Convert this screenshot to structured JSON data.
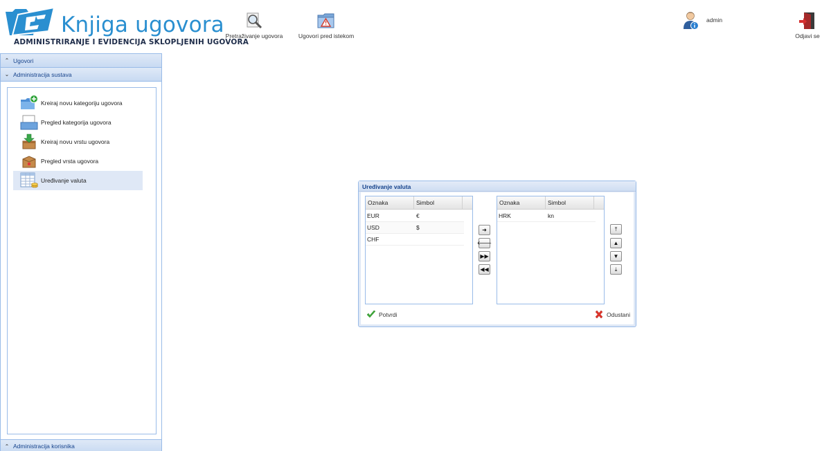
{
  "header": {
    "logo_title": "Knjiga ugovora",
    "logo_subtitle": "ADMINISTRIRANJE I EVIDENCIJA SKLOPLJENIH UGOVORA",
    "buttons": {
      "search": {
        "label": "Pretraživanje ugovora",
        "icon": "magnifier-icon"
      },
      "expired": {
        "label": "Ugovori pred istekom",
        "icon": "folder-warning-icon"
      },
      "logout": {
        "label": "Odjavi se",
        "icon": "exit-door-icon"
      }
    },
    "user": {
      "name": "admin",
      "icon": "user-info-icon"
    }
  },
  "sidebar": {
    "sections": [
      {
        "label": "Ugovori",
        "chevron": "^",
        "state": "collapsed"
      },
      {
        "label": "Administracija sustava",
        "chevron": "v",
        "state": "expanded"
      },
      {
        "label": "Administracija korisnika",
        "chevron": "^",
        "state": "collapsed"
      }
    ],
    "items": [
      {
        "label": "Kreiraj novu kategoriju ugovora",
        "icon": "folder-add-icon"
      },
      {
        "label": "Pregled kategorija ugovora",
        "icon": "folders-list-icon"
      },
      {
        "label": "Kreiraj novu vrstu ugovora",
        "icon": "box-download-icon"
      },
      {
        "label": "Pregled vrsta ugovora",
        "icon": "box-icon"
      },
      {
        "label": "Uređivanje valuta",
        "icon": "currency-table-icon",
        "selected": true
      }
    ]
  },
  "dialog": {
    "title": "Uređivanje valuta",
    "columns": [
      "Oznaka",
      "Simbol"
    ],
    "left_rows": [
      {
        "code": "EUR",
        "symbol": "€"
      },
      {
        "code": "USD",
        "symbol": "$"
      },
      {
        "code": "CHF",
        "symbol": ""
      }
    ],
    "right_rows": [
      {
        "code": "HRK",
        "symbol": "kn"
      }
    ],
    "transfer_buttons": [
      {
        "glyph": "➜",
        "icon": "move-right-icon"
      },
      {
        "glyph": "🡐",
        "icon": "move-left-icon"
      },
      {
        "glyph": "▶▶",
        "icon": "move-all-right-icon"
      },
      {
        "glyph": "◀◀",
        "icon": "move-all-left-icon"
      }
    ],
    "order_buttons": [
      {
        "glyph": "⤒",
        "icon": "move-top-icon"
      },
      {
        "glyph": "▲",
        "icon": "move-up-icon"
      },
      {
        "glyph": "▼",
        "icon": "move-down-icon"
      },
      {
        "glyph": "⤓",
        "icon": "move-bottom-icon"
      }
    ],
    "confirm_label": "Potvrdi",
    "cancel_label": "Odustani"
  },
  "colors": {
    "brand_blue": "#2a8fd0",
    "panel_border": "#99bbe8",
    "header_text": "#15428b",
    "selected_bg": "#dfe8f6"
  }
}
